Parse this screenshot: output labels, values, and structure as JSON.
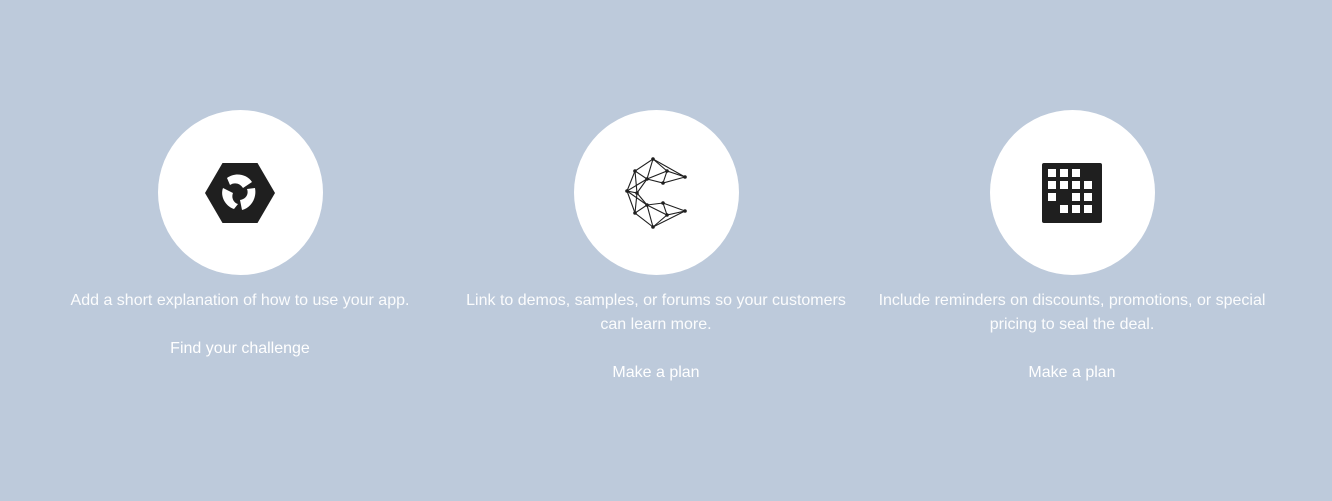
{
  "features": [
    {
      "icon": "hexagon-aperture-icon",
      "description": "Add a short explanation of how to use your app.",
      "link_label": "Find your challenge"
    },
    {
      "icon": "network-c-icon",
      "description": "Link to demos, samples, or forums so your customers can learn more.",
      "link_label": "Make a plan"
    },
    {
      "icon": "pixel-grid-icon",
      "description": "Include reminders on discounts, promotions, or special pricing to seal the deal.",
      "link_label": "Make a plan"
    }
  ],
  "colors": {
    "background": "#bdcadb",
    "circle": "#ffffff",
    "icon": "#1f1f1f",
    "text": "#ffffff"
  }
}
